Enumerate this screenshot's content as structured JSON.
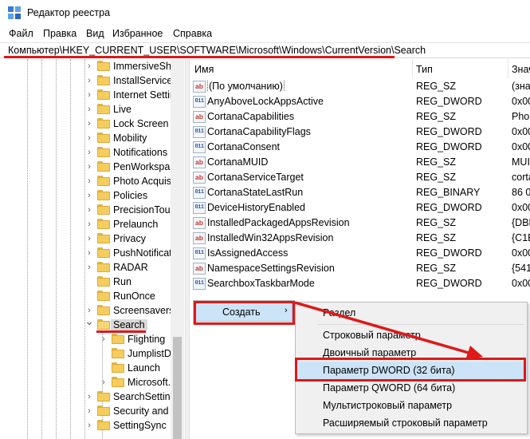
{
  "window": {
    "title": "Редактор реестра"
  },
  "menu": [
    "Файл",
    "Правка",
    "Вид",
    "Избранное",
    "Справка"
  ],
  "address": "Компьютер\\HKEY_CURRENT_USER\\SOFTWARE\\Microsoft\\Windows\\CurrentVersion\\Search",
  "tree": {
    "items": [
      {
        "label": "ImmersiveShe",
        "indent": 0,
        "expander": "collapsed",
        "selected": false
      },
      {
        "label": "InstallService",
        "indent": 0,
        "expander": "collapsed",
        "selected": false
      },
      {
        "label": "Internet Settir",
        "indent": 0,
        "expander": "collapsed",
        "selected": false
      },
      {
        "label": "Live",
        "indent": 0,
        "expander": "collapsed",
        "selected": false
      },
      {
        "label": "Lock Screen",
        "indent": 0,
        "expander": "collapsed",
        "selected": false
      },
      {
        "label": "Mobility",
        "indent": 0,
        "expander": "collapsed",
        "selected": false
      },
      {
        "label": "Notifications",
        "indent": 0,
        "expander": "collapsed",
        "selected": false
      },
      {
        "label": "PenWorkspac",
        "indent": 0,
        "expander": "collapsed",
        "selected": false
      },
      {
        "label": "Photo Acquis",
        "indent": 0,
        "expander": "collapsed",
        "selected": false
      },
      {
        "label": "Policies",
        "indent": 0,
        "expander": "collapsed",
        "selected": false
      },
      {
        "label": "PrecisionTouc",
        "indent": 0,
        "expander": "collapsed",
        "selected": false
      },
      {
        "label": "Prelaunch",
        "indent": 0,
        "expander": "collapsed",
        "selected": false
      },
      {
        "label": "Privacy",
        "indent": 0,
        "expander": "collapsed",
        "selected": false
      },
      {
        "label": "PushNotificat",
        "indent": 0,
        "expander": "collapsed",
        "selected": false
      },
      {
        "label": "RADAR",
        "indent": 0,
        "expander": "collapsed",
        "selected": false
      },
      {
        "label": "Run",
        "indent": 0,
        "expander": "none",
        "selected": false
      },
      {
        "label": "RunOnce",
        "indent": 0,
        "expander": "none",
        "selected": false
      },
      {
        "label": "Screensavers",
        "indent": 0,
        "expander": "collapsed",
        "selected": false
      },
      {
        "label": "Search",
        "indent": 0,
        "expander": "expanded",
        "selected": true
      },
      {
        "label": "Flighting",
        "indent": 1,
        "expander": "collapsed",
        "selected": false
      },
      {
        "label": "JumplistDa",
        "indent": 1,
        "expander": "none",
        "selected": false
      },
      {
        "label": "Launch",
        "indent": 1,
        "expander": "none",
        "selected": false
      },
      {
        "label": "Microsoft.",
        "indent": 1,
        "expander": "collapsed",
        "selected": false
      },
      {
        "label": "SearchSetting",
        "indent": 0,
        "expander": "collapsed",
        "selected": false
      },
      {
        "label": "Security and M",
        "indent": 0,
        "expander": "collapsed",
        "selected": false
      },
      {
        "label": "SettingSync",
        "indent": 0,
        "expander": "collapsed",
        "selected": false
      }
    ]
  },
  "columns": {
    "name": "Имя",
    "type": "Тип",
    "data": "Знач"
  },
  "values": [
    {
      "name": "(По умолчанию)",
      "type": "REG_SZ",
      "data": "(зна",
      "kind": "sz",
      "default": true
    },
    {
      "name": "AnyAboveLockAppsActive",
      "type": "REG_DWORD",
      "data": "0x00",
      "kind": "bin"
    },
    {
      "name": "CortanaCapabilities",
      "type": "REG_SZ",
      "data": "Phor",
      "kind": "sz"
    },
    {
      "name": "CortanaCapabilityFlags",
      "type": "REG_DWORD",
      "data": "0x00",
      "kind": "bin"
    },
    {
      "name": "CortanaConsent",
      "type": "REG_DWORD",
      "data": "0x00",
      "kind": "bin"
    },
    {
      "name": "CortanaMUID",
      "type": "REG_SZ",
      "data": "MUI",
      "kind": "sz"
    },
    {
      "name": "CortanaServiceTarget",
      "type": "REG_SZ",
      "data": "corta",
      "kind": "sz"
    },
    {
      "name": "CortanaStateLastRun",
      "type": "REG_BINARY",
      "data": "86 0",
      "kind": "bin"
    },
    {
      "name": "DeviceHistoryEnabled",
      "type": "REG_DWORD",
      "data": "0x00",
      "kind": "bin"
    },
    {
      "name": "InstalledPackagedAppsRevision",
      "type": "REG_SZ",
      "data": "{DBD",
      "kind": "sz"
    },
    {
      "name": "InstalledWin32AppsRevision",
      "type": "REG_SZ",
      "data": "{C1E",
      "kind": "sz"
    },
    {
      "name": "IsAssignedAccess",
      "type": "REG_DWORD",
      "data": "0x00",
      "kind": "bin"
    },
    {
      "name": "NamespaceSettingsRevision",
      "type": "REG_SZ",
      "data": "{541",
      "kind": "sz"
    },
    {
      "name": "SearchboxTaskbarMode",
      "type": "REG_DWORD",
      "data": "0x00",
      "kind": "bin"
    }
  ],
  "context_menu": {
    "create_label": "Создать",
    "submenu_arrow": "›"
  },
  "submenu": {
    "items": [
      "Раздел",
      "Строковый параметр",
      "Двоичный параметр",
      "Параметр DWORD (32 бита)",
      "Параметр QWORD (64 бита)",
      "Мультистроковый параметр",
      "Расширяемый строковый параметр"
    ]
  },
  "colors": {
    "annotation": "#e01818",
    "highlight": "#cce4f7",
    "menu_bg": "#f0f0f0"
  }
}
